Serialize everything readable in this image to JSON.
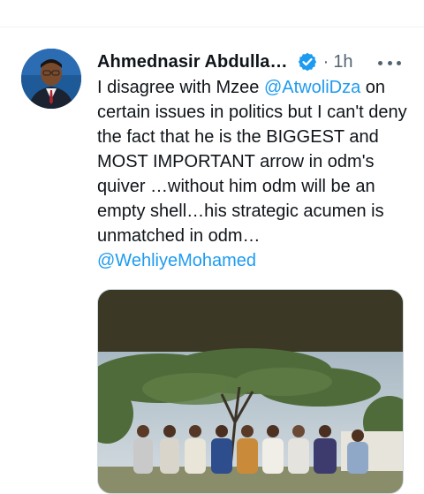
{
  "tweet": {
    "author_name": "Ahmednasir Abdulla…",
    "separator": "·",
    "time": "1h",
    "text_parts": [
      "I disagree with Mzee ",
      "@AtwoliDza",
      " on certain issues in politics but I can't deny the fact that he is the BIGGEST and MOST IMPORTANT arrow in odm's quiver …without him odm will be an empty shell…his strategic acumen is unmatched in odm…",
      "@WehliyeMohamed"
    ]
  },
  "colors": {
    "link": "#1d9bf0",
    "verified": "#1d9bf0",
    "text": "#0f1419",
    "secondary": "#536471"
  },
  "icons": {
    "verified": "verified-badge-icon",
    "more": "more-horizontal-icon"
  }
}
